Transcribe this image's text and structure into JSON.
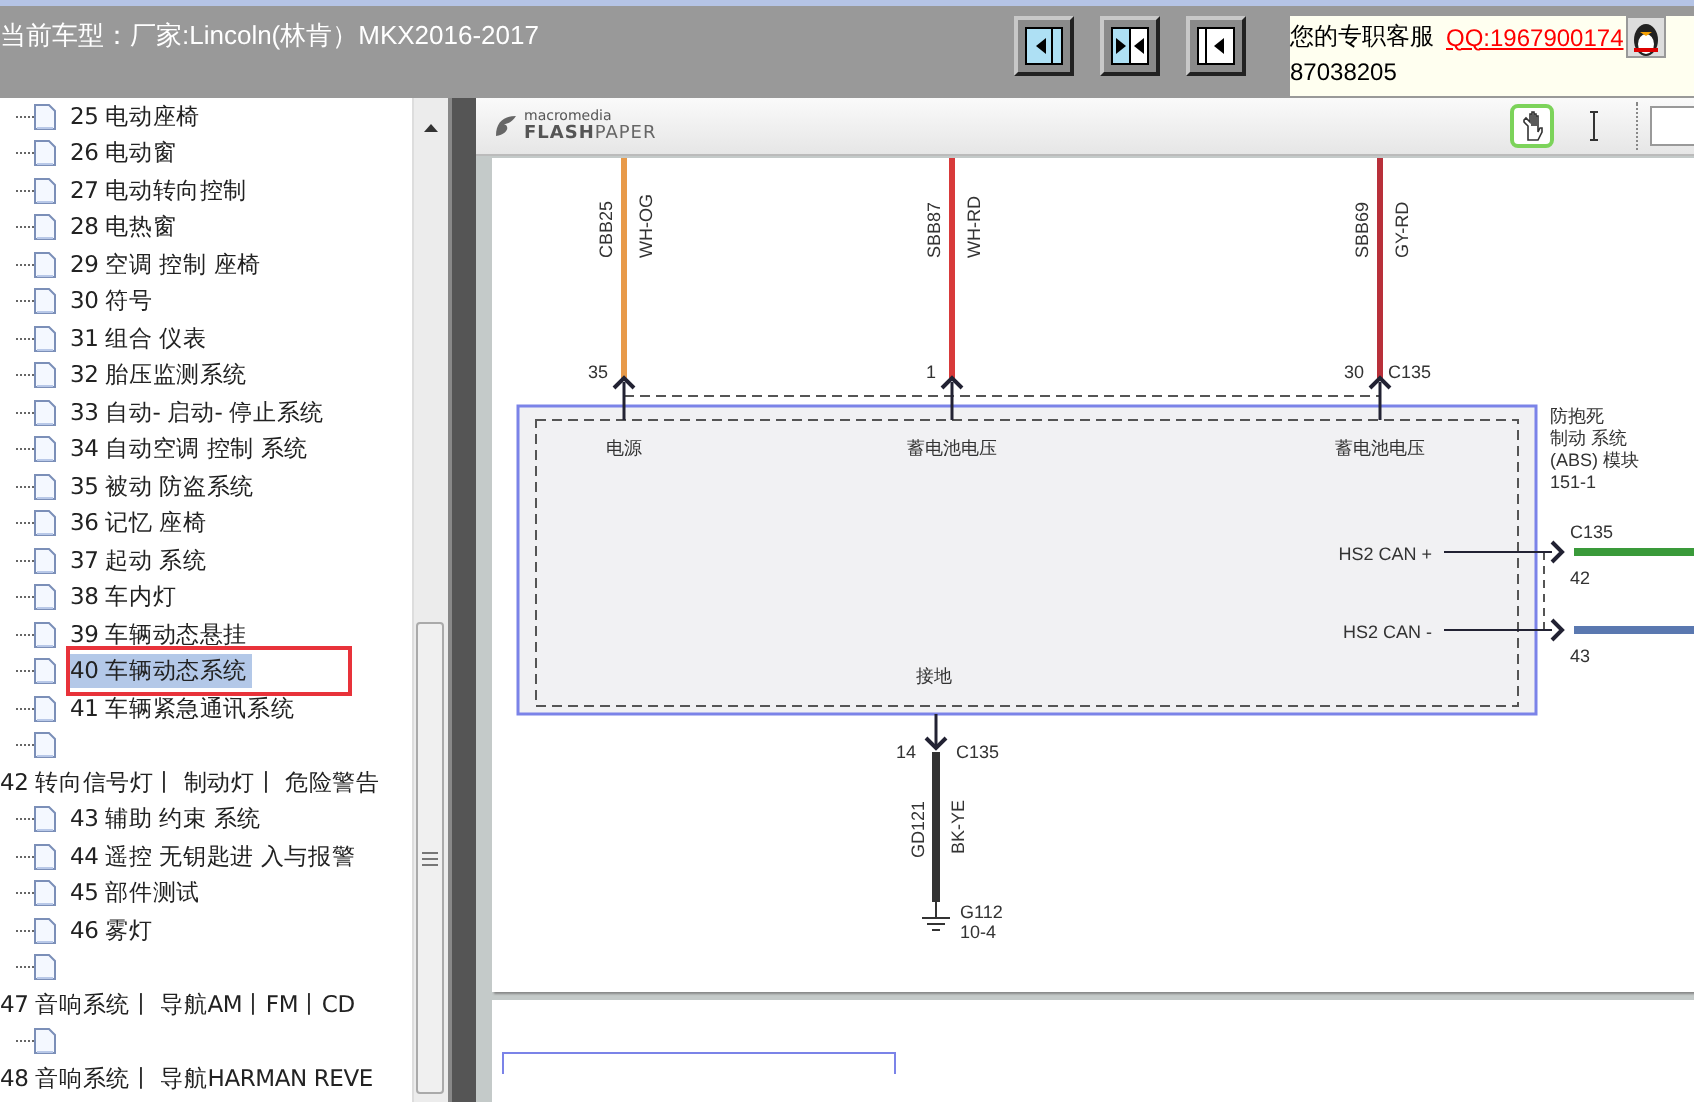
{
  "header": {
    "title": "当前车型：厂家:Lincoln(林肯）MKX2016-2017",
    "view_buttons": [
      {
        "kind": "left"
      },
      {
        "kind": "both"
      },
      {
        "kind": "right"
      }
    ],
    "support": {
      "label": "您的专职客服",
      "qq": "QQ:1967900174",
      "number": "87038205"
    }
  },
  "tree": [
    {
      "children": [
        {
          "label": "25 电动座椅",
          "selected": false,
          "outlined": false
        },
        {
          "label": "26 电动窗",
          "selected": false,
          "outlined": false
        },
        {
          "label": "27 电动转向控制",
          "selected": false,
          "outlined": false
        },
        {
          "label": "28 电热窗",
          "selected": false,
          "outlined": false
        },
        {
          "label": "29 空调 控制 座椅",
          "selected": false,
          "outlined": false
        },
        {
          "label": "30 符号",
          "selected": false,
          "outlined": false
        },
        {
          "label": "31 组合 仪表",
          "selected": false,
          "outlined": false
        },
        {
          "label": "32 胎压监测系统",
          "selected": false,
          "outlined": false
        },
        {
          "label": "33 自动- 启动- 停止系统",
          "selected": false,
          "outlined": false
        },
        {
          "label": "34 自动空调 控制 系统",
          "selected": false,
          "outlined": false
        },
        {
          "label": "35 被动 防盗系统",
          "selected": false,
          "outlined": false
        },
        {
          "label": "36 记忆 座椅",
          "selected": false,
          "outlined": false
        },
        {
          "label": "37 起动 系统",
          "selected": false,
          "outlined": false
        },
        {
          "label": "38 车内灯",
          "selected": false,
          "outlined": false
        },
        {
          "label": "39 车辆动态悬挂",
          "selected": false,
          "outlined": false
        },
        {
          "label": "40 车辆动态系统",
          "selected": true,
          "outlined": true
        },
        {
          "label": "41 车辆紧急通讯系统",
          "selected": false,
          "outlined": false
        },
        {
          "selected": false,
          "outlined": false
        }
      ]
    },
    {
      "label": "42 转向信号灯丨 制动灯丨 危险警告",
      "children": [
        {
          "label": "43 辅助 约束 系统",
          "selected": false,
          "outlined": false
        },
        {
          "label": "44 遥控 无钥匙进 入与报警",
          "selected": false,
          "outlined": false
        },
        {
          "label": "45 部件测试",
          "selected": false,
          "outlined": false
        },
        {
          "label": "46 雾灯",
          "selected": false,
          "outlined": false
        },
        {
          "selected": false,
          "outlined": false
        }
      ]
    },
    {
      "label": "47 音响系统丨 导航AM丨FM丨CD",
      "children": [
        {
          "selected": false,
          "outlined": false
        }
      ]
    },
    {
      "label": "48 音响系统丨 导航HARMAN REVE"
    }
  ],
  "viewer": {
    "logo_top": "macromedia",
    "logo_main": "**FLASH**PAPER",
    "tools": [
      {
        "kind": "hand",
        "selected": true
      },
      {
        "kind": "text",
        "selected": false
      }
    ],
    "diagram": {
      "top_wires": [
        {
          "circuit": "CBB25",
          "color_code": "WH-OG",
          "pin": "35",
          "pin_label": "电源",
          "color": "#e89a4a"
        },
        {
          "circuit": "SBB87",
          "color_code": "WH-RD",
          "pin": "1",
          "pin_label": "蓄电池电压",
          "color": "#d83a3a"
        },
        {
          "circuit": "SBB69",
          "color_code": "GY-RD",
          "pin": "30",
          "connector": "C135",
          "pin_label": "蓄电池电压",
          "color": "#b8303a"
        }
      ],
      "module": {
        "name_lines": [
          "防抱死",
          "制动 系统",
          "(ABS) 模块",
          "151-1"
        ]
      },
      "can_lines": [
        {
          "label": "HS2 CAN +",
          "pin": "42",
          "connector": "C135",
          "color": "#3a9a3a"
        },
        {
          "label": "HS2 CAN -",
          "pin": "43",
          "color": "#5a78b0"
        }
      ],
      "ground": {
        "pin_label": "接地",
        "pin": "14",
        "connector": "C135",
        "circuit": "GD121",
        "color_code": "BK-YE",
        "ground_id": "G112",
        "location": "10-4",
        "color": "#333333"
      }
    }
  }
}
